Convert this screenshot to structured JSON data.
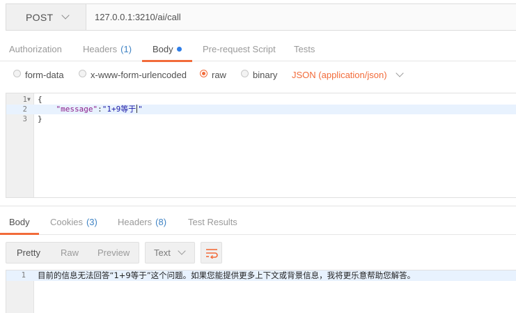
{
  "request": {
    "method": "POST",
    "url": "127.0.0.1:3210/ai/call"
  },
  "request_tabs": [
    {
      "label": "Authorization",
      "count": ""
    },
    {
      "label": "Headers",
      "count": "(1)"
    },
    {
      "label": "Body",
      "count": ""
    },
    {
      "label": "Pre-request Script",
      "count": ""
    },
    {
      "label": "Tests",
      "count": ""
    }
  ],
  "body_types": {
    "options": [
      "form-data",
      "x-www-form-urlencoded",
      "raw",
      "binary"
    ],
    "selected": "raw",
    "format": "JSON (application/json)"
  },
  "editor": {
    "lines": [
      {
        "num": "1",
        "text": "{"
      },
      {
        "num": "2",
        "key": "\"message\"",
        "sep": ":",
        "value": "\"1+9等于",
        "tail": "\""
      },
      {
        "num": "3",
        "text": "}"
      }
    ]
  },
  "response_tabs": [
    {
      "label": "Body",
      "count": ""
    },
    {
      "label": "Cookies",
      "count": "(3)"
    },
    {
      "label": "Headers",
      "count": "(8)"
    },
    {
      "label": "Test Results",
      "count": ""
    }
  ],
  "view_modes": [
    "Pretty",
    "Raw",
    "Preview"
  ],
  "view_selected": "Pretty",
  "text_format": "Text",
  "response": {
    "line_num": "1",
    "text": "目前的信息无法回答“1+9等于”这个问题。如果您能提供更多上下文或背景信息，我将更乐意帮助您解答。"
  },
  "colors": {
    "accent": "#f26b3a",
    "count": "#3f83c4",
    "dot": "#2f7ee8"
  }
}
